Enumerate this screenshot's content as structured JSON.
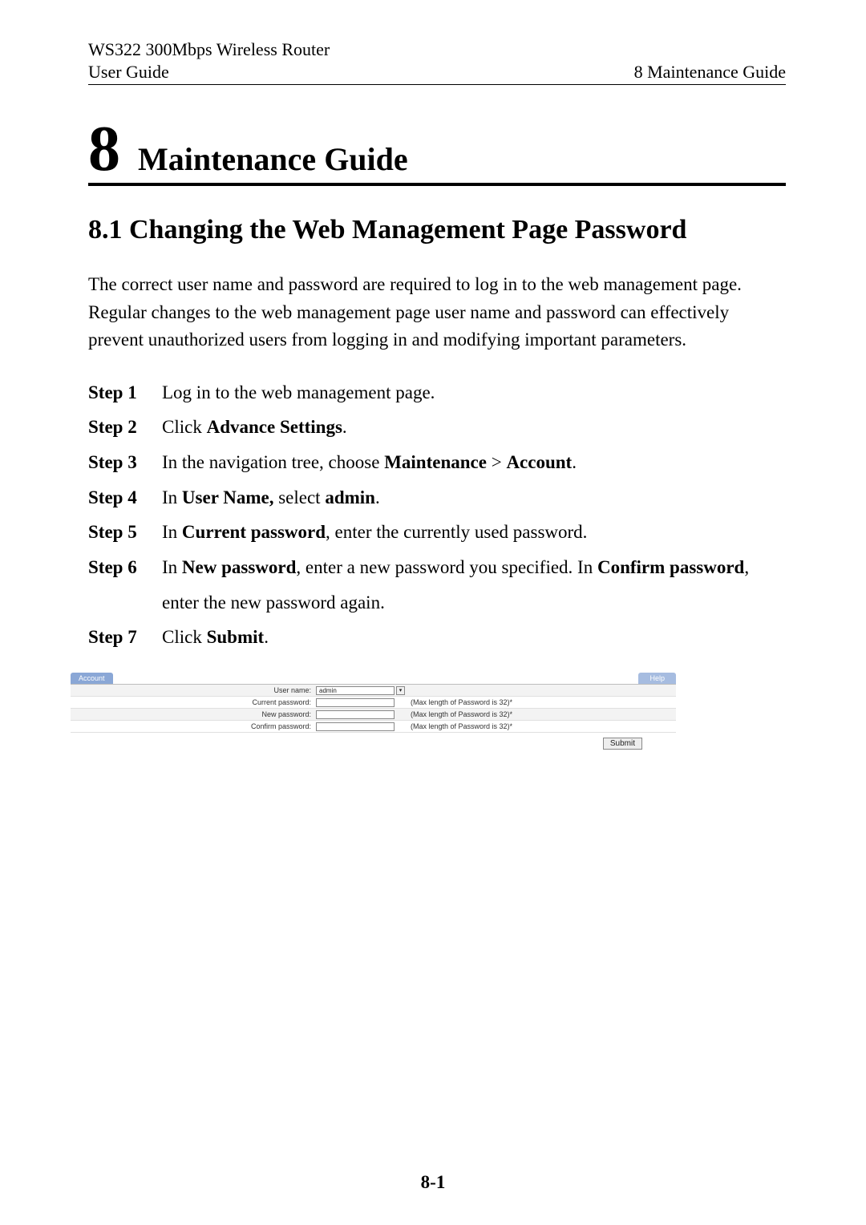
{
  "header": {
    "product": "WS322 300Mbps Wireless Router",
    "left": "User Guide",
    "right": "8 Maintenance Guide"
  },
  "chapter": {
    "num": "8",
    "title": "Maintenance Guide"
  },
  "section": {
    "title": "8.1 Changing the Web Management Page Password",
    "intro": "The correct user name and password are required to log in to the web management page. Regular changes to the web management page user name and password can effectively prevent unauthorized users from logging in and modifying important parameters."
  },
  "steps": [
    {
      "label": "Step 1",
      "html": "Log in to the web management page."
    },
    {
      "label": "Step 2",
      "html": "Click <b>Advance Settings</b>."
    },
    {
      "label": "Step 3",
      "html": "In the navigation tree, choose <b>Maintenance</b> &gt; <b>Account</b>."
    },
    {
      "label": "Step 4",
      "html": "In <b>User Name,</b> select <b>admin</b>."
    },
    {
      "label": "Step 5",
      "html": "In <b>Current password</b>, enter the currently used password."
    },
    {
      "label": "Step 6",
      "html": "In <b>New password</b>, enter a new password you specified. In <b>Confirm password</b>, enter the new password again."
    },
    {
      "label": "Step 7",
      "html": "Click <b>Submit</b>."
    }
  ],
  "shot": {
    "tab_account": "Account",
    "tab_help": "Help",
    "labels": {
      "username": "User name:",
      "current": "Current password:",
      "newpw": "New password:",
      "confirm": "Confirm password:"
    },
    "username_value": "admin",
    "hint": "(Max length of Password is 32)*",
    "submit": "Submit"
  },
  "page_number": "8-1"
}
